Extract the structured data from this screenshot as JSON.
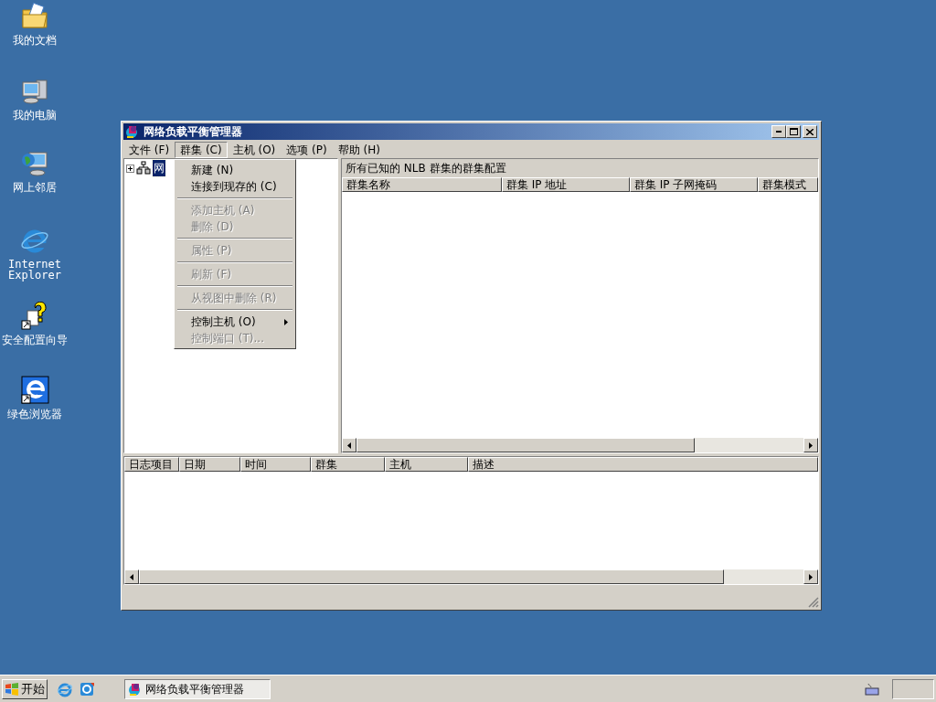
{
  "desktop_icons": [
    {
      "kind": "documents",
      "label": "我的文档"
    },
    {
      "kind": "computer",
      "label": "我的电脑"
    },
    {
      "kind": "network",
      "label": "网上邻居"
    },
    {
      "kind": "ie",
      "label": "Internet Explorer"
    },
    {
      "kind": "wizard",
      "label": "安全配置向导"
    },
    {
      "kind": "browser",
      "label": "绿色浏览器"
    }
  ],
  "window": {
    "title": "网络负载平衡管理器",
    "menu_bar": [
      {
        "label": "文件 (F)",
        "selected": false
      },
      {
        "label": "群集 (C)",
        "selected": true
      },
      {
        "label": "主机 (O)",
        "selected": false
      },
      {
        "label": "选项 (P)",
        "selected": false
      },
      {
        "label": "帮助 (H)",
        "selected": false
      }
    ],
    "tree": {
      "items": [
        {
          "label": "网",
          "expanded": false,
          "selected": true
        }
      ]
    },
    "cluster_panel": {
      "heading": "所有已知的 NLB 群集的群集配置",
      "columns": [
        "群集名称",
        "群集 IP 地址",
        "群集 IP 子网掩码",
        "群集模式"
      ]
    },
    "log_panel": {
      "columns": [
        "日志项目",
        "日期",
        "时间",
        "群集",
        "主机",
        "描述"
      ]
    },
    "dropdown_menu": {
      "groups": [
        [
          {
            "label": "新建 (N)",
            "disabled": false,
            "submenu": false
          },
          {
            "label": "连接到现存的 (C)",
            "disabled": false,
            "submenu": false
          }
        ],
        [
          {
            "label": "添加主机 (A)",
            "disabled": true,
            "submenu": false
          },
          {
            "label": "删除 (D)",
            "disabled": true,
            "submenu": false
          }
        ],
        [
          {
            "label": "属性 (P)",
            "disabled": true,
            "submenu": false
          }
        ],
        [
          {
            "label": "刷新 (F)",
            "disabled": true,
            "submenu": false
          }
        ],
        [
          {
            "label": "从视图中删除 (R)",
            "disabled": true,
            "submenu": false
          }
        ],
        [
          {
            "label": "控制主机 (O)",
            "disabled": false,
            "submenu": true
          },
          {
            "label": "控制端口 (T)...",
            "disabled": true,
            "submenu": false
          }
        ]
      ]
    }
  },
  "taskbar": {
    "start": "开始",
    "tasks": [
      {
        "label": "网络负载平衡管理器",
        "selected": true
      }
    ]
  }
}
